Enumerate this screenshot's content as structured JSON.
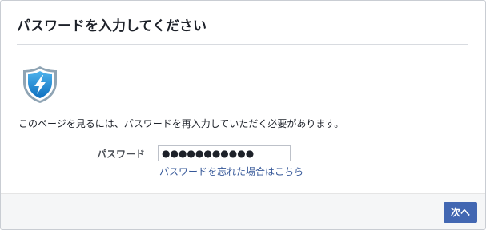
{
  "dialog": {
    "title": "パスワードを入力してください",
    "icon": "shield-lightning-icon",
    "message": "このページを見るには、パスワードを再入力していただく必要があります。",
    "password_label": "パスワード",
    "password_value": "●●●●●●●●●●●",
    "forgot_link": "パスワードを忘れた場合はこちら",
    "next_button": "次へ"
  },
  "colors": {
    "accent": "#4267b2",
    "link": "#365899",
    "shield_fill": "#1a8ad6",
    "footer_bg": "#f5f6f7"
  }
}
